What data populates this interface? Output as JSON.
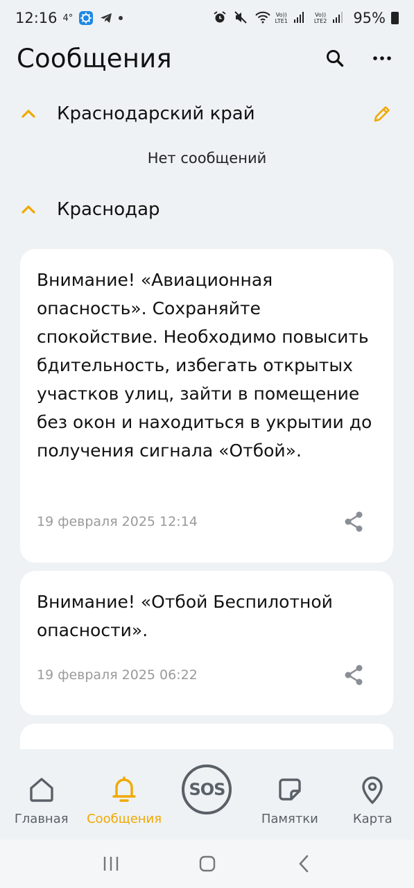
{
  "status_bar": {
    "time": "12:16",
    "temp": "4°",
    "battery": "95%",
    "sim1": "LTE1",
    "sim2": "LTE2",
    "volte": "Vo))"
  },
  "header": {
    "title": "Сообщения"
  },
  "sections": [
    {
      "title": "Краснодарский край",
      "empty_text": "Нет сообщений"
    },
    {
      "title": "Краснодар"
    }
  ],
  "messages": [
    {
      "text": "Внимание! «Авиационная опасность». Сохраняйте спокойствие. Необходимо повысить бдительность, избегать открытых участков улиц, зайти в помещение без окон и находиться в укрытии до получения сигнала «Отбой».",
      "date": "19 февраля 2025 12:14"
    },
    {
      "text": "Внимание! «Отбой Беспилотной опасности».",
      "date": "19 февраля 2025 06:22"
    }
  ],
  "bottom_nav": {
    "home": "Главная",
    "messages": "Сообщения",
    "sos": "SOS",
    "memos": "Памятки",
    "map": "Карта"
  },
  "colors": {
    "accent": "#f0a800",
    "background": "#eef2f4",
    "card": "#ffffff",
    "nav_icon": "#5a6068"
  },
  "icons": {
    "search": "search-icon",
    "more": "more-icon",
    "edit": "pencil-icon",
    "collapse": "chevron-up-icon",
    "share": "share-icon"
  }
}
